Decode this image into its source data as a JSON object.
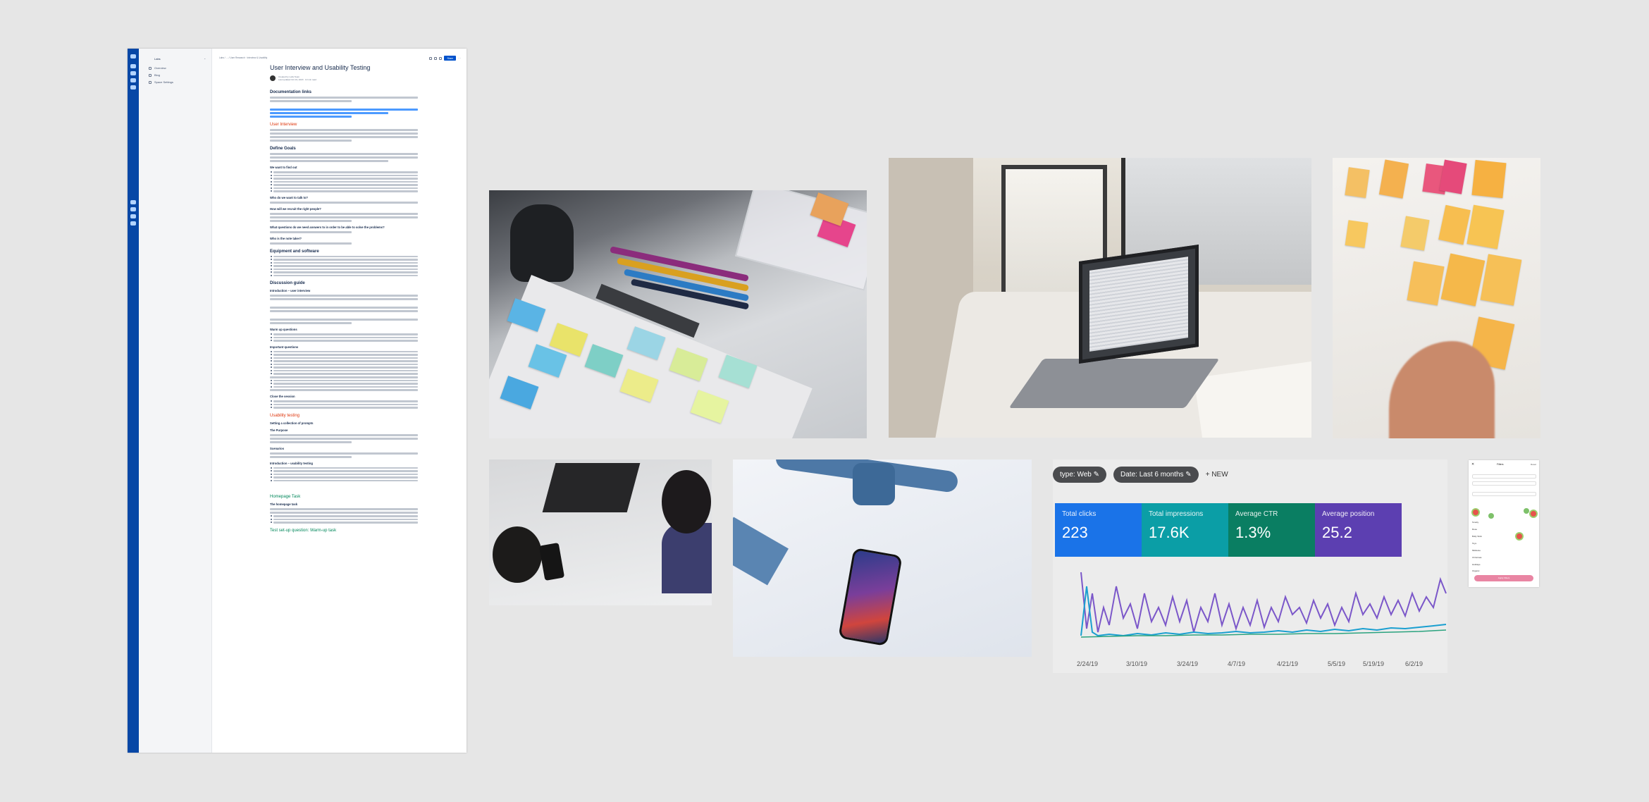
{
  "confluence": {
    "space_name": "Labs",
    "sidebar": [
      "Overview",
      "Blog",
      "Space Settings"
    ],
    "breadcrumb": "Labs / … / User Research   ·   Interview & Usability",
    "share_label": "Share",
    "more_label": "···",
    "title": "User Interview and Usability Testing",
    "author_line1": "Created by Labs Team",
    "author_line2": "Last updated Oct 19, 2020  ·  10 min read",
    "headings": {
      "documentation_links": "Documentation links",
      "user_interview": "User Interview",
      "define_goals": "Define Goals",
      "equipment": "Equipment and software",
      "discussion_guide": "Discussion guide",
      "usability_testing": "Usability testing",
      "homepage_task": "Homepage Task",
      "warm_up": "Test set-up question: Warm-up task"
    },
    "subheads": {
      "want_to_learn": "We want to find out",
      "who_to_talk": "Who do we want to talk to?",
      "how_recruit": "How will we recruit the right people?",
      "what_questions": "What questions do we need answers to in order to be able to solve the problems?",
      "notes_taker": "Who is the note taker?",
      "intro": "Introduction – user interview",
      "warm_up_q": "Warm up questions",
      "important_q": "Important questions",
      "close": "Close the session",
      "setting": "Setting a collection of prompts",
      "purpose": "The Purpose",
      "scenarios": "Scenarios",
      "intro_usability": "Introduction – usability testing",
      "homepage_sub": "The homepage task"
    }
  },
  "analytics": {
    "chips": [
      "type: Web",
      "Date: Last 6 months"
    ],
    "new_label": "NEW",
    "cards": [
      {
        "label": "Total clicks",
        "value": "223",
        "color": "#1a73e8"
      },
      {
        "label": "Total impressions",
        "value": "17.6K",
        "color": "#0b9ea6"
      },
      {
        "label": "Average CTR",
        "value": "1.3%",
        "color": "#0a7e62"
      },
      {
        "label": "Average position",
        "value": "25.2",
        "color": "#5c3fb1"
      }
    ],
    "dates": [
      "2/24/19",
      "3/10/19",
      "3/24/19",
      "4/7/19",
      "4/21/19",
      "5/5/19",
      "5/19/19",
      "6/2/19"
    ]
  },
  "mobile": {
    "close": "✕",
    "title": "Filters",
    "reset": "Reset",
    "rows": [
      "Smoky",
      "Rose",
      "Bully Stick",
      "Toys",
      "Mistletoe",
      "Christmas",
      "Holidays",
      "Organic"
    ],
    "apply": "Apply Filters"
  },
  "colors": {
    "page_bg": "#e6e6e6",
    "confluence_rail": "#0747a6",
    "link": "#0052cc",
    "red_heading": "#de350b",
    "green_heading": "#00875a"
  }
}
